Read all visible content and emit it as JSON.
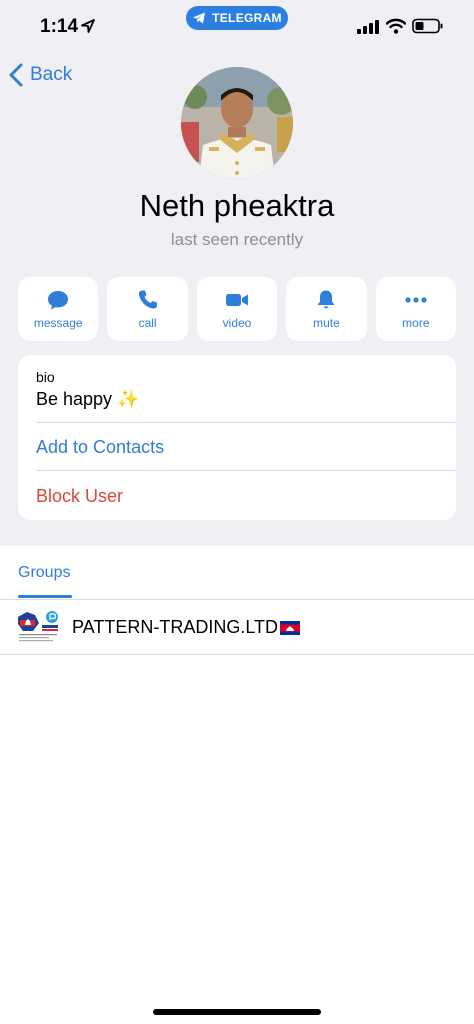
{
  "status_bar": {
    "time": "1:14",
    "app_pill": "TELEGRAM"
  },
  "nav": {
    "back_label": "Back"
  },
  "profile": {
    "name": "Neth pheaktra",
    "status": "last seen recently"
  },
  "actions": [
    {
      "label": "message",
      "icon": "message-bubble-icon"
    },
    {
      "label": "call",
      "icon": "phone-icon"
    },
    {
      "label": "video",
      "icon": "video-camera-icon"
    },
    {
      "label": "mute",
      "icon": "bell-icon"
    },
    {
      "label": "more",
      "icon": "ellipsis-icon"
    }
  ],
  "info": {
    "bio_label": "bio",
    "bio_value": "Be happy ✨",
    "add_contact": "Add to Contacts",
    "block_user": "Block User"
  },
  "groups": {
    "tab_label": "Groups",
    "items": [
      {
        "name": "PATTERN-TRADING.LTD"
      }
    ]
  },
  "colors": {
    "accent": "#2f7ed8",
    "danger": "#d9483b",
    "background": "#efeff4",
    "pill": "#2b7fe0"
  }
}
